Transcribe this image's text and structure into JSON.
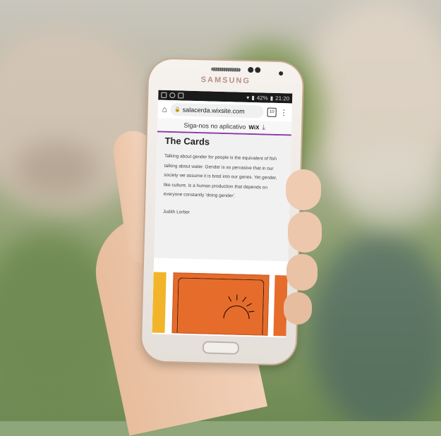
{
  "phone": {
    "brand": "SAMSUNG"
  },
  "status_bar": {
    "battery": "42%",
    "time": "21:20"
  },
  "browser": {
    "url": "salacerda.wixsite.com",
    "tab_count": "10"
  },
  "app_banner": {
    "text": "Siga-nos no aplicativo",
    "brand": "WiX"
  },
  "page": {
    "title": "The Cards",
    "quote": "Talking about gender for people is the equivalent of fish talking about water. Gender is so pervasive that in our society we assume it is bred into our genes. Yet gender, like culture, is a human production that depends on everyone constantly 'doing gender'.",
    "author": "Judith Lorber"
  },
  "colors": {
    "card_orange": "#e66c2c",
    "card_yellow": "#f2b52a",
    "wix_accent": "#8e3aa8"
  }
}
